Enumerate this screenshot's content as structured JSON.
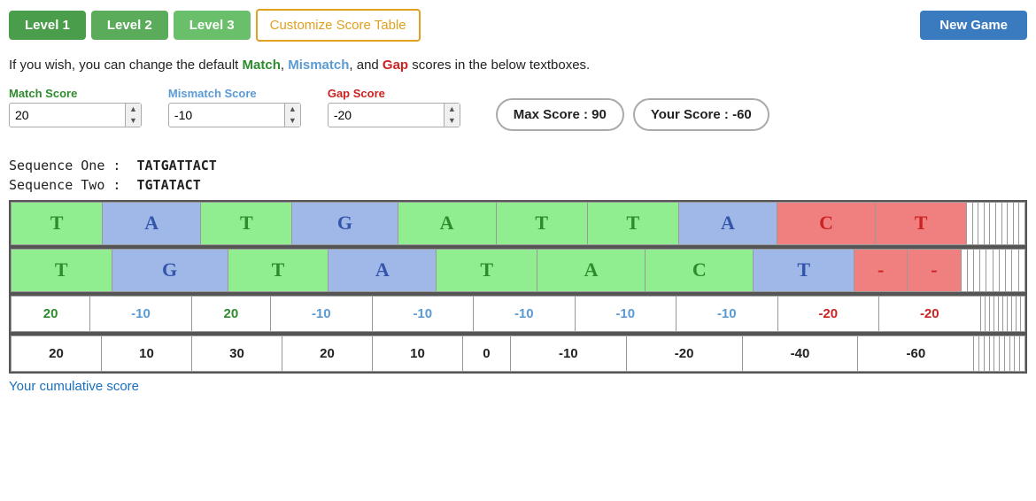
{
  "toolbar": {
    "level1_label": "Level 1",
    "level2_label": "Level 2",
    "level3_label": "Level 3",
    "customize_label": "Customize Score Table",
    "new_game_label": "New Game"
  },
  "info": {
    "text_before": "If you wish, you can change the default ",
    "match_word": "Match",
    "text_middle1": ", ",
    "mismatch_word": "Mismatch",
    "text_middle2": ", and ",
    "gap_word": "Gap",
    "text_after": " scores in the below textboxes."
  },
  "scores": {
    "match_label": "Match Score",
    "match_value": "20",
    "mismatch_label": "Mismatch Score",
    "mismatch_value": "-10",
    "gap_label": "Gap Score",
    "gap_value": "-20",
    "max_score_label": "Max Score : 90",
    "your_score_label": "Your Score : -60"
  },
  "sequences": {
    "seq1_label": "Sequence One :",
    "seq1_value": "TATGATTACT",
    "seq2_label": "Sequence Two :",
    "seq2_value": "TGTATACT"
  },
  "alignment": {
    "row1": [
      {
        "char": "T",
        "type": "green"
      },
      {
        "char": "A",
        "type": "blue"
      },
      {
        "char": "T",
        "type": "green"
      },
      {
        "char": "G",
        "type": "blue"
      },
      {
        "char": "A",
        "type": "green"
      },
      {
        "char": "T",
        "type": "green"
      },
      {
        "char": "T",
        "type": "green"
      },
      {
        "char": "A",
        "type": "blue"
      },
      {
        "char": "C",
        "type": "red"
      },
      {
        "char": "T",
        "type": "red"
      },
      {
        "char": "",
        "type": "empty"
      },
      {
        "char": "",
        "type": "empty"
      },
      {
        "char": "",
        "type": "empty"
      },
      {
        "char": "",
        "type": "empty"
      },
      {
        "char": "",
        "type": "empty"
      },
      {
        "char": "",
        "type": "empty"
      },
      {
        "char": "",
        "type": "empty"
      },
      {
        "char": "",
        "type": "empty"
      },
      {
        "char": "",
        "type": "empty"
      },
      {
        "char": "",
        "type": "empty"
      }
    ],
    "row2": [
      {
        "char": "T",
        "type": "green"
      },
      {
        "char": "G",
        "type": "blue"
      },
      {
        "char": "T",
        "type": "green"
      },
      {
        "char": "A",
        "type": "blue"
      },
      {
        "char": "T",
        "type": "green"
      },
      {
        "char": "A",
        "type": "green"
      },
      {
        "char": "C",
        "type": "green"
      },
      {
        "char": "T",
        "type": "blue"
      },
      {
        "char": "-",
        "type": "red"
      },
      {
        "char": "-",
        "type": "red"
      },
      {
        "char": "",
        "type": "empty"
      },
      {
        "char": "",
        "type": "empty"
      },
      {
        "char": "",
        "type": "empty"
      },
      {
        "char": "",
        "type": "empty"
      },
      {
        "char": "",
        "type": "empty"
      },
      {
        "char": "",
        "type": "empty"
      },
      {
        "char": "",
        "type": "empty"
      },
      {
        "char": "",
        "type": "empty"
      },
      {
        "char": "",
        "type": "empty"
      },
      {
        "char": "",
        "type": "empty"
      }
    ],
    "score_row": [
      {
        "val": "20",
        "type": "positive"
      },
      {
        "val": "-10",
        "type": "negative"
      },
      {
        "val": "20",
        "type": "positive"
      },
      {
        "val": "-10",
        "type": "negative"
      },
      {
        "val": "-10",
        "type": "negative"
      },
      {
        "val": "-10",
        "type": "negative"
      },
      {
        "val": "-10",
        "type": "negative"
      },
      {
        "val": "-10",
        "type": "negative"
      },
      {
        "val": "-20",
        "type": "neg-red"
      },
      {
        "val": "-20",
        "type": "neg-red"
      },
      {
        "val": "",
        "type": "empty"
      },
      {
        "val": "",
        "type": "empty"
      },
      {
        "val": "",
        "type": "empty"
      },
      {
        "val": "",
        "type": "empty"
      },
      {
        "val": "",
        "type": "empty"
      },
      {
        "val": "",
        "type": "empty"
      },
      {
        "val": "",
        "type": "empty"
      },
      {
        "val": "",
        "type": "empty"
      },
      {
        "val": "",
        "type": "empty"
      },
      {
        "val": "",
        "type": "empty"
      }
    ],
    "cumul_row": [
      {
        "val": "20",
        "type": "normal"
      },
      {
        "val": "10",
        "type": "normal"
      },
      {
        "val": "30",
        "type": "normal"
      },
      {
        "val": "20",
        "type": "normal"
      },
      {
        "val": "10",
        "type": "normal"
      },
      {
        "val": "0",
        "type": "normal"
      },
      {
        "val": "-10",
        "type": "normal"
      },
      {
        "val": "-20",
        "type": "normal"
      },
      {
        "val": "-40",
        "type": "normal"
      },
      {
        "val": "-60",
        "type": "normal"
      },
      {
        "val": "",
        "type": "empty"
      },
      {
        "val": "",
        "type": "empty"
      },
      {
        "val": "",
        "type": "empty"
      },
      {
        "val": "",
        "type": "empty"
      },
      {
        "val": "",
        "type": "empty"
      },
      {
        "val": "",
        "type": "empty"
      },
      {
        "val": "",
        "type": "empty"
      },
      {
        "val": "",
        "type": "empty"
      },
      {
        "val": "",
        "type": "empty"
      },
      {
        "val": "",
        "type": "empty"
      }
    ]
  },
  "cumulative_label": "Your cumulative score"
}
